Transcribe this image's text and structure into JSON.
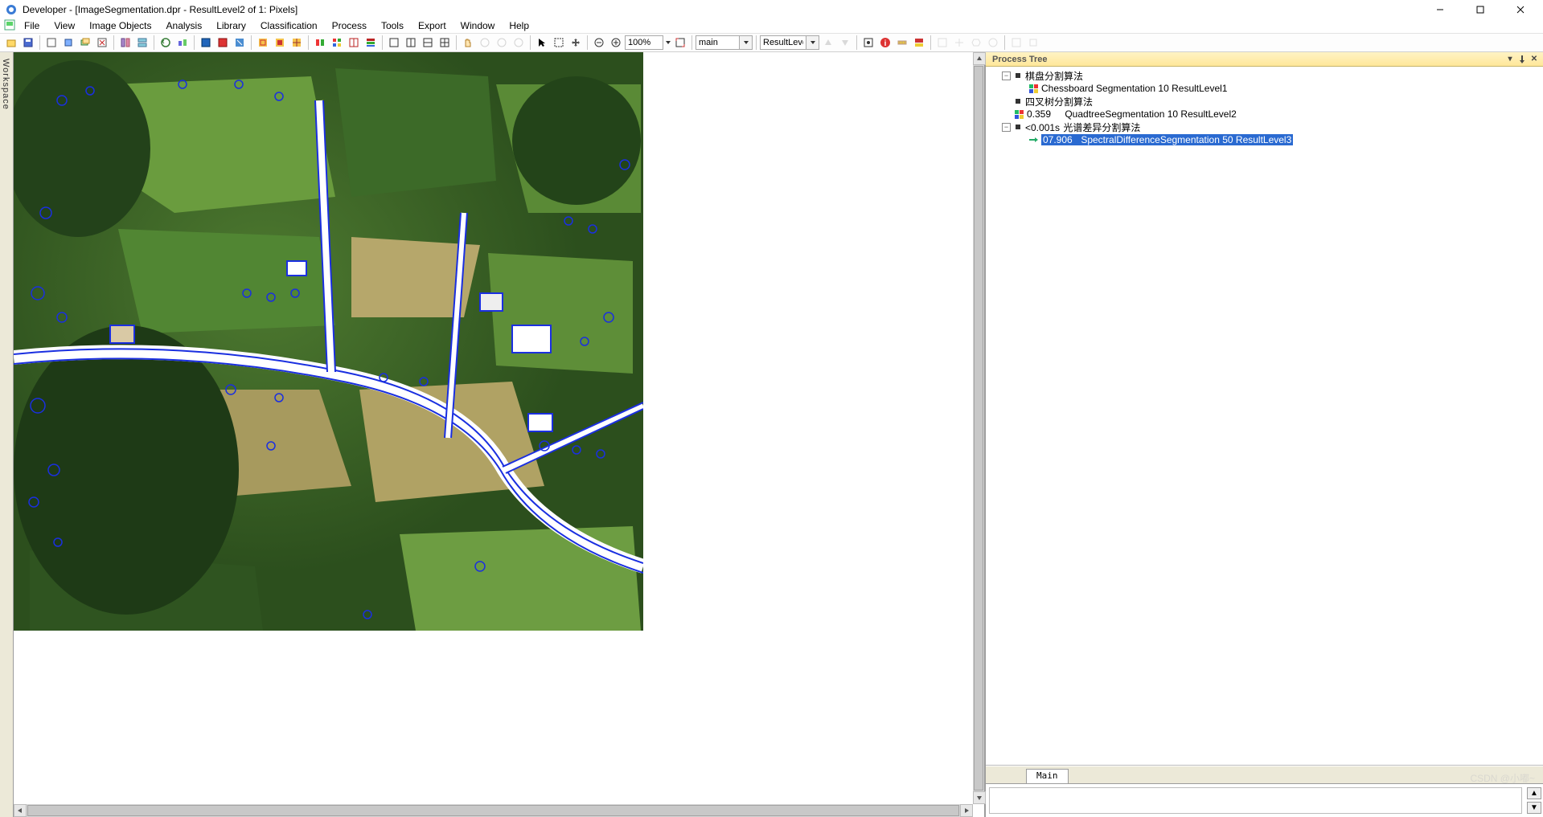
{
  "title": "Developer - [ImageSegmentation.dpr - ResultLevel2 of 1: Pixels]",
  "menu": {
    "file": "File",
    "view": "View",
    "imageObjects": "Image Objects",
    "analysis": "Analysis",
    "library": "Library",
    "classification": "Classification",
    "process": "Process",
    "tools": "Tools",
    "export": "Export",
    "window": "Window",
    "help": "Help"
  },
  "toolbar": {
    "zoom": "100%",
    "combo1": "main",
    "combo2": "ResultLeve"
  },
  "sidepanel": {
    "label": "Workspace"
  },
  "imagepane": {
    "overlay": "main"
  },
  "process_tree": {
    "title": "Process Tree",
    "nodes": [
      {
        "depth": 0,
        "toggle": "-",
        "bullet": true,
        "text": "棋盘分割算法"
      },
      {
        "depth": 1,
        "icon": "sq",
        "text": "Chessboard Segmentation 10 ResultLevel1"
      },
      {
        "depth": 0,
        "bullet": true,
        "text": "四叉树分割算法"
      },
      {
        "depth": 0,
        "icon": "sq",
        "time": "0.359",
        "text": "QuadtreeSegmentation 10 ResultLevel2"
      },
      {
        "depth": 0,
        "toggle": "-",
        "bullet": true,
        "time": "<0.001s",
        "text": "光谱差异分割算法"
      },
      {
        "depth": 1,
        "icon": "arrow",
        "time": "07.906",
        "text": "SpectralDifferenceSegmentation 50 ResultLevel3",
        "selected": true
      }
    ],
    "tab": "Main"
  },
  "watermark": "CSDN @小嘟~"
}
